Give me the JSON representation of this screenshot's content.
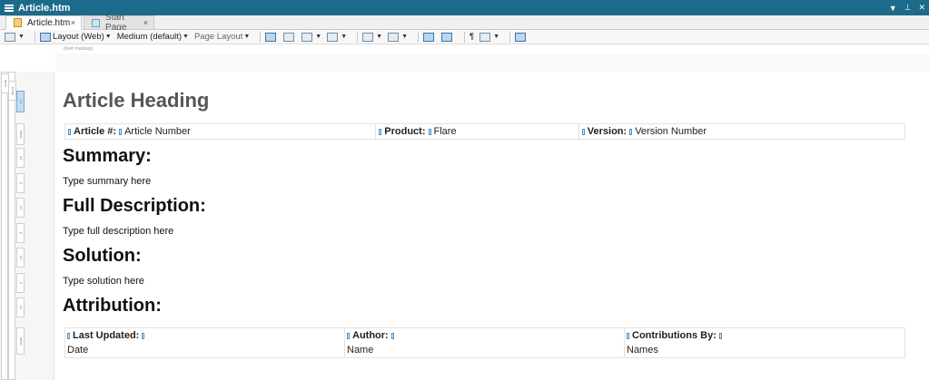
{
  "window": {
    "title": "Article.htm"
  },
  "tabs": [
    {
      "label": "Article.htm",
      "close": "×"
    },
    {
      "label": "Start Page",
      "close": "×"
    }
  ],
  "toolbar": {
    "layout": "Layout (Web)",
    "medium": "Medium (default)",
    "page_layout": "Page Layout"
  },
  "structure_bar": "(text markup)",
  "document": {
    "heading": "Article Heading",
    "info_table": [
      {
        "label": "Article #:",
        "value": "Article Number"
      },
      {
        "label": "Product:",
        "value": "Flare"
      },
      {
        "label": "Version:",
        "value": "Version Number"
      }
    ],
    "sections": [
      {
        "title": "Summary:",
        "body": "Type summary here"
      },
      {
        "title": "Full Description:",
        "body": "Type full description here"
      },
      {
        "title": "Solution:",
        "body": "Type solution here"
      }
    ],
    "attribution_title": "Attribution:",
    "attribution_table": {
      "headers": [
        "Last Updated:",
        "Author:",
        "Contributions By:"
      ],
      "values": [
        "Date",
        "Name",
        "Names"
      ]
    }
  },
  "gutter_labels": {
    "html": "html",
    "body": "body",
    "h1": "h1",
    "table": "table",
    "h2": "h2",
    "p": "p"
  }
}
